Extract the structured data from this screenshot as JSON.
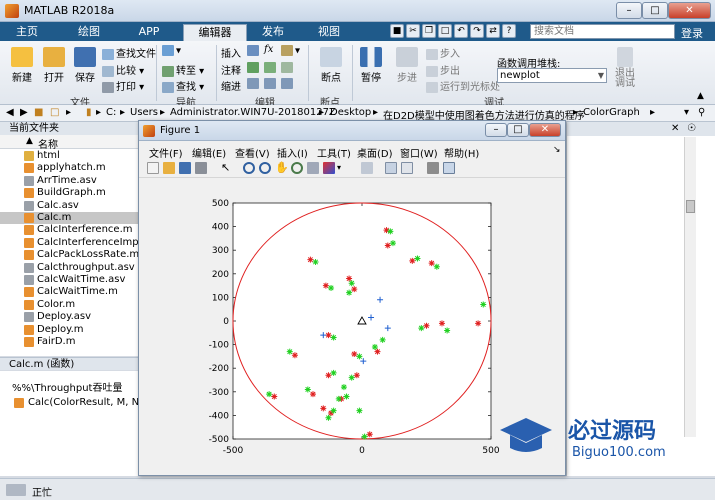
{
  "titlebar": {
    "title": "MATLAB R2018a"
  },
  "tabs": [
    {
      "label": "主页"
    },
    {
      "label": "绘图"
    },
    {
      "label": "APP"
    },
    {
      "label": "编辑器"
    },
    {
      "label": "发布"
    },
    {
      "label": "视图"
    }
  ],
  "search": {
    "placeholder": "搜索文档"
  },
  "login_label": "登录",
  "ribbon": {
    "file": {
      "new": "新建",
      "open": "打开",
      "save": "保存",
      "find_files": "查找文件",
      "compare": "比较",
      "print": "打印",
      "group": "文件"
    },
    "nav": {
      "goto": "转至",
      "find": "查找",
      "group": "导航"
    },
    "edit": {
      "insert": "插入",
      "comment": "注释",
      "indent": "缩进",
      "fx": "fx",
      "group": "编辑"
    },
    "breakpoints": {
      "label": "断点",
      "group": "断点"
    },
    "debug": {
      "pause": "暂停",
      "step": "步进",
      "step_in": "步入",
      "step_out": "步出",
      "run_to_cursor": "运行到光标处",
      "stack_label": "函数调用堆栈:",
      "stack_value": "newplot",
      "quit": "退出调试",
      "group": "调试"
    }
  },
  "address": {
    "path": [
      "C:",
      "Users",
      "Administrator.WIN7U-20180127Z",
      "Desktop",
      "在D2D模型中使用图着色方法进行仿真的程序",
      "ColorGraph"
    ]
  },
  "current_folder": {
    "title": "当前文件夹",
    "column_name": "名称",
    "files": [
      {
        "name": "html",
        "type": "folder"
      },
      {
        "name": "applyhatch.m",
        "type": "m"
      },
      {
        "name": "ArrTime.asv",
        "type": "asv"
      },
      {
        "name": "BuildGraph.m",
        "type": "m"
      },
      {
        "name": "Calc.asv",
        "type": "asv"
      },
      {
        "name": "Calc.m",
        "type": "m",
        "selected": true
      },
      {
        "name": "CalcInterference.m",
        "type": "m"
      },
      {
        "name": "CalcInterferenceImpact",
        "type": "m"
      },
      {
        "name": "CalcPackLossRate.m",
        "type": "m"
      },
      {
        "name": "Calcthroughput.asv",
        "type": "asv"
      },
      {
        "name": "CalcWaitTime.asv",
        "type": "asv"
      },
      {
        "name": "CalcWaitTime.m",
        "type": "m"
      },
      {
        "name": "Color.m",
        "type": "m"
      },
      {
        "name": "Deploy.asv",
        "type": "asv"
      },
      {
        "name": "Deploy.m",
        "type": "m"
      },
      {
        "name": "FairD.m",
        "type": "m"
      }
    ]
  },
  "details": {
    "title": "Calc.m  (函数)",
    "comment": "%%\\Throughput吞吐量",
    "signature": "Calc(ColorResult, M, N, C"
  },
  "status": {
    "text": "正忙"
  },
  "figure": {
    "title": "Figure 1",
    "menu": [
      "文件(F)",
      "编辑(E)",
      "查看(V)",
      "插入(I)",
      "工具(T)",
      "桌面(D)",
      "窗口(W)",
      "帮助(H)"
    ]
  },
  "chart_data": {
    "type": "scatter",
    "title": "",
    "xlabel": "",
    "ylabel": "",
    "xlim": [
      -500,
      500
    ],
    "ylim": [
      -500,
      500
    ],
    "xticks": [
      -500,
      0,
      500
    ],
    "yticks": [
      500,
      400,
      300,
      200,
      100,
      0,
      -100,
      -200,
      -300,
      -400,
      -500
    ],
    "circle": {
      "cx": 0,
      "cy": 0,
      "r": 500,
      "color": "#e02020"
    },
    "center_marker": {
      "x": 0,
      "y": 0,
      "marker": "triangle"
    },
    "series": [
      {
        "color": "#e02020",
        "marker": "*",
        "x": [
          95,
          -200,
          -140,
          -50,
          -30,
          195,
          270,
          -130,
          250,
          310,
          -30,
          -130,
          -340,
          -150,
          -190,
          -260,
          60,
          -80,
          30,
          -120,
          -20,
          450,
          100
        ],
        "y": [
          385,
          260,
          150,
          180,
          135,
          255,
          245,
          -230,
          -20,
          -10,
          -140,
          -60,
          -320,
          -370,
          -310,
          -145,
          -130,
          -330,
          -480,
          -390,
          -230,
          -10,
          320
        ]
      },
      {
        "color": "#20d020",
        "marker": "*",
        "x": [
          110,
          -180,
          -120,
          -40,
          -50,
          215,
          290,
          -110,
          230,
          330,
          -10,
          -110,
          -360,
          -130,
          -210,
          -280,
          50,
          -60,
          10,
          -110,
          -40,
          470,
          120,
          -10,
          -70,
          -90,
          80
        ],
        "y": [
          380,
          250,
          140,
          160,
          120,
          265,
          230,
          -220,
          -30,
          -40,
          -150,
          -70,
          -310,
          -410,
          -290,
          -130,
          -110,
          -320,
          -490,
          -380,
          -240,
          70,
          330,
          -380,
          -280,
          -330,
          -80
        ]
      },
      {
        "color": "#2060d0",
        "marker": "+",
        "x": [
          70,
          35,
          100,
          -150,
          5
        ],
        "y": [
          90,
          15,
          -30,
          -60,
          -170
        ]
      }
    ]
  }
}
